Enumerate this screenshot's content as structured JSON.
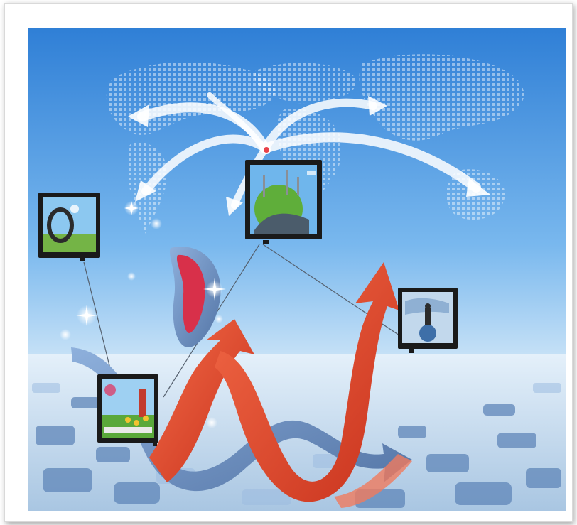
{
  "image": {
    "subject": "business-growth-illustration",
    "monitors": [
      {
        "name": "monitor-left",
        "screen_theme": "landscape-ring"
      },
      {
        "name": "monitor-center",
        "screen_theme": "green-globe-city"
      },
      {
        "name": "monitor-right",
        "screen_theme": "world-map-figure"
      },
      {
        "name": "monitor-bottom",
        "screen_theme": "flower-garden"
      }
    ]
  },
  "palette": {
    "sky_top": "#2f7fd6",
    "sky_mid": "#79b8ee",
    "sky_low": "#d3e8f8",
    "floor": "#c7dced",
    "puzzle": "#5f86b8",
    "red_arrow": "#e4492d",
    "blue_ribbon": "#6d8fbf"
  }
}
